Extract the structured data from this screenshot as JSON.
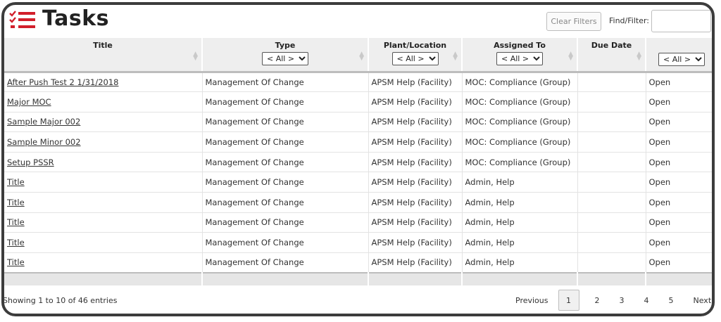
{
  "header": {
    "title": "Tasks",
    "clear_filters": "Clear Filters",
    "find_label": "Find/Filter:",
    "find_value": ""
  },
  "table": {
    "columns": [
      {
        "label": "Title",
        "filter": ""
      },
      {
        "label": "Type",
        "filter": "< All >"
      },
      {
        "label": "Plant/Location",
        "filter": "< All >"
      },
      {
        "label": "Assigned To",
        "filter": "< All >"
      },
      {
        "label": "Due Date",
        "filter": ""
      },
      {
        "label": "",
        "filter": "< All >"
      }
    ],
    "rows": [
      {
        "title": "After Push Test 2 1/31/2018",
        "type": "Management Of Change",
        "plant": "APSM Help (Facility)",
        "assigned": "MOC: Compliance (Group)",
        "due": "",
        "status": "Open"
      },
      {
        "title": "Major MOC",
        "type": "Management Of Change",
        "plant": "APSM Help (Facility)",
        "assigned": "MOC: Compliance (Group)",
        "due": "",
        "status": "Open"
      },
      {
        "title": "Sample Major 002",
        "type": "Management Of Change",
        "plant": "APSM Help (Facility)",
        "assigned": "MOC: Compliance (Group)",
        "due": "",
        "status": "Open"
      },
      {
        "title": "Sample Minor 002",
        "type": "Management Of Change",
        "plant": "APSM Help (Facility)",
        "assigned": "MOC: Compliance (Group)",
        "due": "",
        "status": "Open"
      },
      {
        "title": "Setup PSSR",
        "type": "Management Of Change",
        "plant": "APSM Help (Facility)",
        "assigned": "MOC: Compliance (Group)",
        "due": "",
        "status": "Open"
      },
      {
        "title": "Title",
        "type": "Management Of Change",
        "plant": "APSM Help (Facility)",
        "assigned": "Admin, Help",
        "due": "",
        "status": "Open"
      },
      {
        "title": "Title",
        "type": "Management Of Change",
        "plant": "APSM Help (Facility)",
        "assigned": "Admin, Help",
        "due": "",
        "status": "Open"
      },
      {
        "title": "Title",
        "type": "Management Of Change",
        "plant": "APSM Help (Facility)",
        "assigned": "Admin, Help",
        "due": "",
        "status": "Open"
      },
      {
        "title": "Title",
        "type": "Management Of Change",
        "plant": "APSM Help (Facility)",
        "assigned": "Admin, Help",
        "due": "",
        "status": "Open"
      },
      {
        "title": "Title",
        "type": "Management Of Change",
        "plant": "APSM Help (Facility)",
        "assigned": "Admin, Help",
        "due": "",
        "status": "Open"
      }
    ]
  },
  "footer": {
    "info": "Showing 1 to 10 of 46 entries",
    "previous": "Previous",
    "pages": [
      "1",
      "2",
      "3",
      "4",
      "5"
    ],
    "current_page": "1",
    "next": "Next"
  },
  "colors": {
    "logo_red": "#d21f2b",
    "header_bg": "#eeeeee",
    "frame": "#3c3c3c"
  }
}
